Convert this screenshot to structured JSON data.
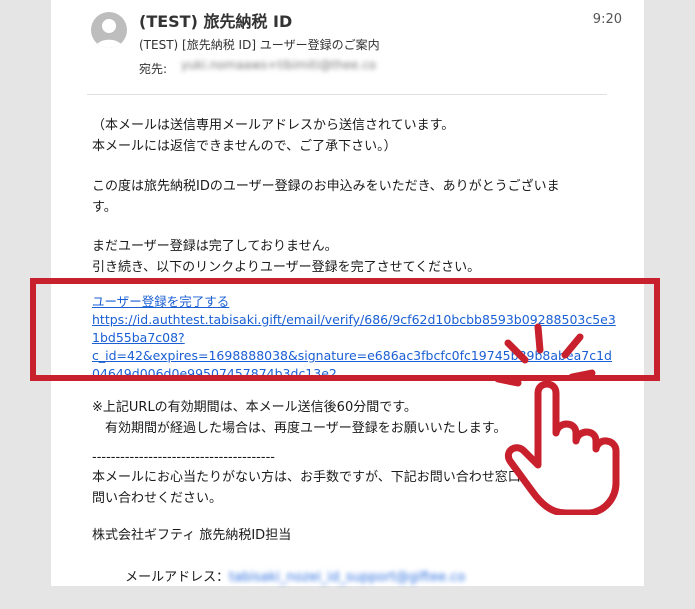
{
  "header": {
    "sender": "(TEST) 旅先納税 ID",
    "time": "9:20",
    "subject": "(TEST) [旅先納税 ID] ユーザー登録のご案内",
    "to_label": "宛先:",
    "to_address": "yuki.nomaaws+tibimiti@thee.co"
  },
  "body": {
    "intro_line1": "（本メールは送信専用メールアドレスから送信されています。",
    "intro_line2": "本メールには返信できませんので、ご了承下さい。）",
    "thanks_line1": "この度は旅先納税IDのユーザー登録のお申込みをいただき、ありがとうございま",
    "thanks_line2": "す。",
    "notice_line1": "まだユーザー登録は完了しておりません。",
    "notice_line2": "引き続き、以下のリンクよりユーザー登録を完了させてください。",
    "link_label": "ユーザー登録を完了する",
    "link_url_line1": "https://id.authtest.tabisaki.gift/email/verify/686/9cf62d10bcbb8593b09288503c5e3",
    "link_url_line2": "1bd55ba7c08?",
    "link_url_line3": "c_id=42&expires=1698888038&signature=e686ac3fbcfc0fc19745b89b8abea7c1d",
    "link_url_line4": "04649d006d0e99507457874b3dc13e2",
    "expiry_line1": "※上記URLの有効期間は、本メール送信後60分間です。",
    "expiry_line2": "　有効期間が経過した場合は、再度ユーザー登録をお願いいたします。",
    "separator": "---------------------------------------",
    "contact_line1": "本メールにお心当たりがない方は、お手数ですが、下記お問い合わせ窓口まで",
    "contact_line2": "問い合わせください。",
    "company": "株式会社ギフティ 旅先納税ID担当",
    "mail_label": "メールアドレス：",
    "mail_address": "tabisaki_nozei_id_support@giftee.co"
  },
  "colors": {
    "highlight": "#c8202c",
    "link": "#1a5fd4"
  },
  "icons": {
    "avatar": "person-avatar-icon",
    "pointer": "tapping-hand-icon"
  }
}
